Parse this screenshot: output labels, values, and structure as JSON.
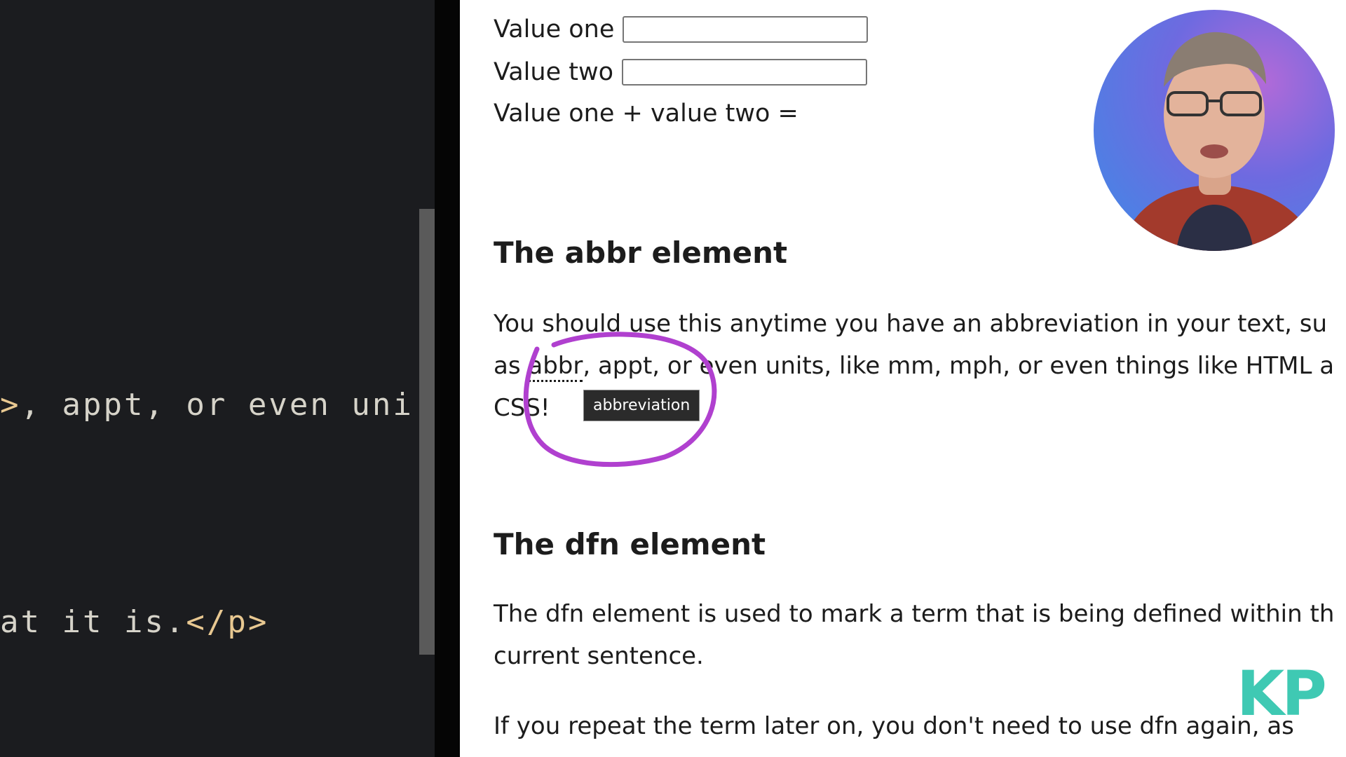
{
  "editor": {
    "line1": {
      "tag": ">",
      "text": ", appt, or even uni"
    },
    "line2": {
      "text": "at it is.",
      "tag": "</p>"
    }
  },
  "form": {
    "value_one_label": "Value one",
    "value_two_label": "Value two",
    "sum_label": "Value one + value two ="
  },
  "abbr_section": {
    "title": "The abbr element",
    "line1": "You should use this anytime you have an abbreviation in your text, su",
    "line2_pre": "as ",
    "line2_abbr": "abbr",
    "line2_post": ", appt, or even units, like mm, mph, or even things like HTML a",
    "line3": "CSS!",
    "tooltip": "abbreviation"
  },
  "dfn_section": {
    "title": "The dfn element",
    "line1": "The dfn element is used to mark a term that is being defined within th",
    "line2": "current sentence.",
    "line3": "If you repeat the term later on, you don't need to use dfn again, as"
  },
  "logo": {
    "text": "KP"
  },
  "colors": {
    "annotation": "#b040cf",
    "logo": "#3fc9b3",
    "editor_bg": "#1b1c1f",
    "code_tag": "#e8c891"
  }
}
